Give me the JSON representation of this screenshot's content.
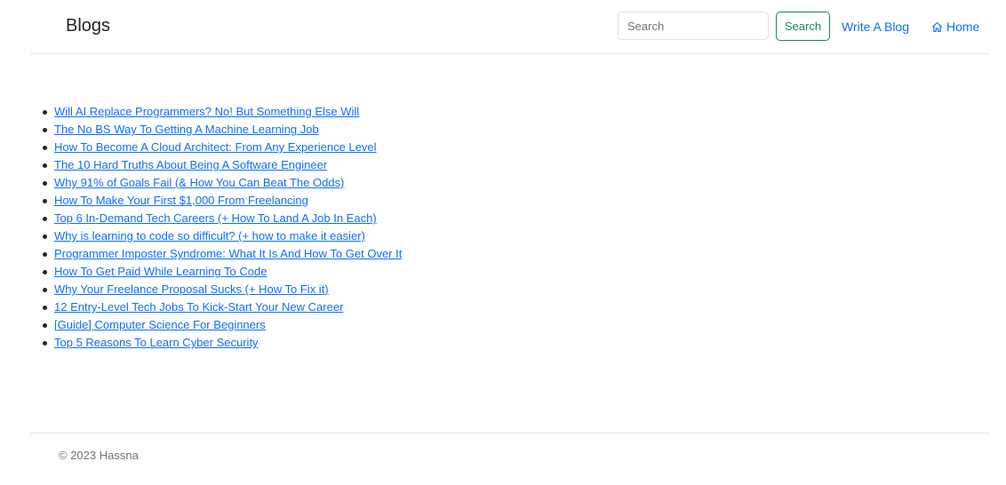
{
  "header": {
    "brand": "Blogs",
    "search_placeholder": "Search",
    "search_button": "Search",
    "nav": {
      "write": "Write A Blog",
      "home": "Home"
    }
  },
  "blogs": [
    "Will AI Replace Programmers? No! But Something Else Will",
    "The No BS Way To Getting A Machine Learning Job",
    "How To Become A Cloud Architect: From Any Experience Level",
    "The 10 Hard Truths About Being A Software Engineer",
    "Why 91% of Goals Fail (& How You Can Beat The Odds)",
    "How To Make Your First $1,000 From Freelancing",
    "Top 6 In-Demand Tech Careers (+ How To Land A Job In Each)",
    "Why is learning to code so difficult? (+ how to make it easier)",
    "Programmer Imposter Syndrome: What It Is And How To Get Over It",
    "How To Get Paid While Learning To Code",
    "Why Your Freelance Proposal Sucks (+ How To Fix it)",
    "12 Entry-Level Tech Jobs To Kick-Start Your New Career",
    "[Guide] Computer Science For Beginners",
    "Top 5 Reasons To Learn Cyber Security"
  ],
  "footer": {
    "copyright": "© 2023 Hassna"
  },
  "colors": {
    "link": "#0d6efd",
    "success": "#198754",
    "muted": "#6c757d"
  }
}
